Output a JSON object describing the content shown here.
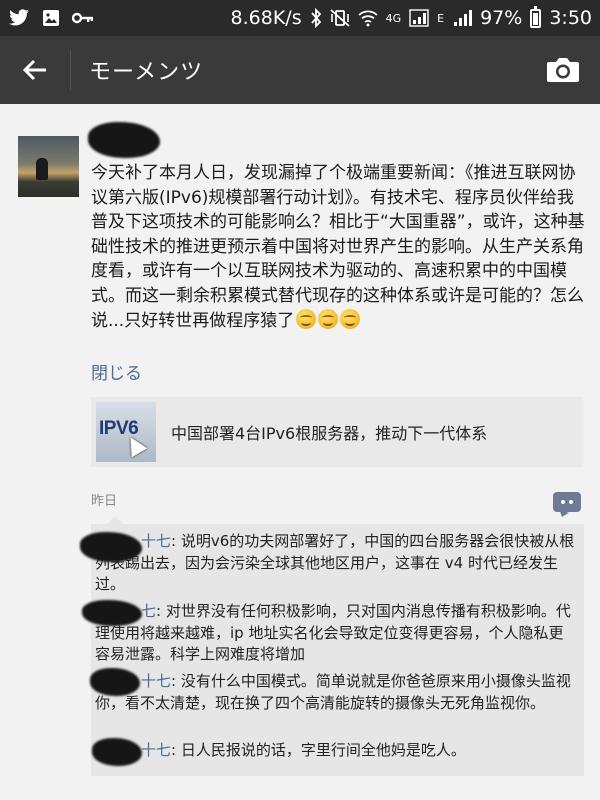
{
  "status_bar": {
    "speed": "8.68K/s",
    "network_4g": "4G",
    "network_e": "E",
    "battery": "97%",
    "time": "3:50"
  },
  "app_bar": {
    "title": "モーメンツ",
    "icons": [
      "back-arrow-icon",
      "camera-icon"
    ]
  },
  "post": {
    "text": "今天补了本月人日，发现漏掉了个极端重要新闻：《推进互联网协议第六版(IPv6)规模部署行动计划》。有技术宅、程序员伙伴给我普及下这项技术的可能影响么？相比于“大国重器”，或许，这种基础性技术的推进更预示着中国将对世界产生的影响。从生产关系角度看，或许有一个以互联网技术为驱动的、高速积累中的中国模式。而这一剩余积累模式替代现存的这种体系或许是可能的？怎么说...只好转世再做程序猿了",
    "emojis": [
      "smile-emoji",
      "smile-emoji",
      "smile-emoji"
    ],
    "collapse_label": "閉じる",
    "link": {
      "thumbnail_text": "IPV6",
      "title": "中国部署4台IPv6根服务器，推动下一代体系"
    },
    "time": "昨日"
  },
  "comments": [
    {
      "name": "十七",
      "text": "说明v6的功夫网部署好了，中国的四台服务器会很快被从根列表踢出去，因为会污染全球其他地区用户，这事在 v4 时代已经发生过。"
    },
    {
      "name": "七",
      "text": "对世界没有任何积极影响，只对国内消息传播有积极影响。代理使用将越来越难，ip 地址实名化会导致定位变得更容易，个人隐私更容易泄露。科学上网难度将增加"
    },
    {
      "name": "十七",
      "text": "没有什么中国模式。简单说就是你爸爸原来用小摄像头监视你，看不太清楚，现在换了四个高清能旋转的摄像头无死角监视你。"
    },
    {
      "name": "十七",
      "text": "日人民报说的话，字里行间全他妈是吃人。"
    }
  ]
}
